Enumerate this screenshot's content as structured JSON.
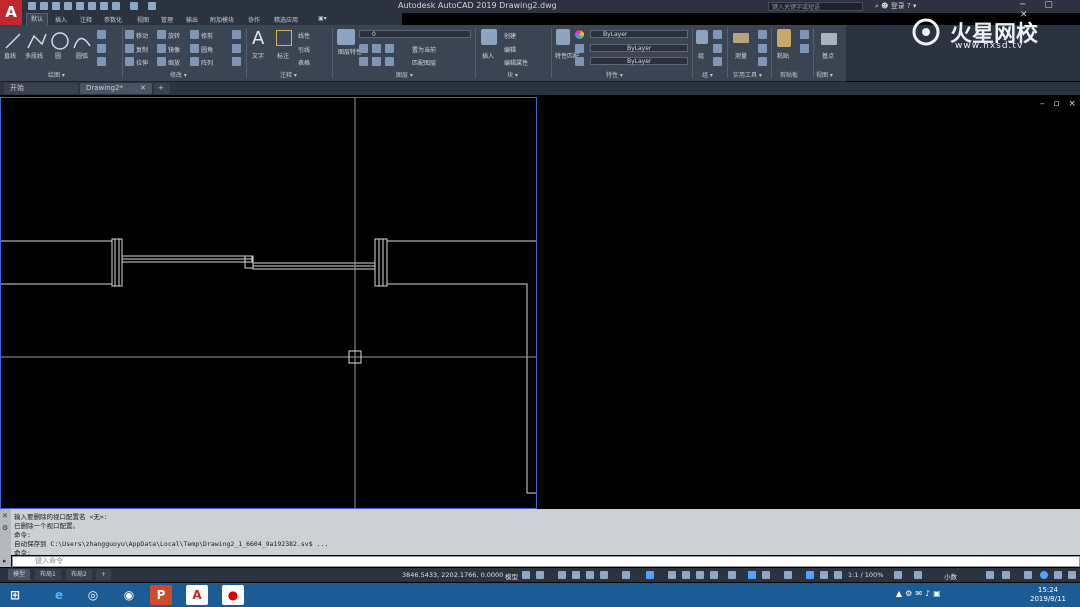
{
  "app": {
    "logo": "A",
    "title": "Autodesk AutoCAD 2019    Drawing2.dwg"
  },
  "titlebar": {
    "search_placeholder": "键入关键字或短语",
    "user": "登录",
    "controls": "─ ▢ ✕"
  },
  "ribbon_tabs": [
    "默认",
    "插入",
    "注释",
    "参数化",
    "视图",
    "管理",
    "输出",
    "附加模块",
    "协作",
    "精选应用"
  ],
  "panels": {
    "draw": {
      "label": "绘图 ▾",
      "tools": [
        "直线",
        "多段线",
        "圆",
        "圆弧"
      ]
    },
    "modify": {
      "label": "修改 ▾",
      "tools": [
        "移动",
        "旋转",
        "修剪",
        "复制",
        "镜像",
        "圆角",
        "拉伸",
        "缩放",
        "阵列"
      ]
    },
    "annotation": {
      "label": "注释 ▾",
      "tools": [
        "文字",
        "标注",
        "线性",
        "引线",
        "表格"
      ]
    },
    "layers": {
      "label": "图层 ▾",
      "tools": [
        "图层特性",
        "置为当前",
        "匹配图层"
      ],
      "current": "0"
    },
    "block": {
      "label": "块 ▾",
      "tools": [
        "插入",
        "创建",
        "编辑",
        "编辑属性"
      ]
    },
    "properties": {
      "label": "特性 ▾",
      "tools": [
        "特性匹配"
      ],
      "color": "ByLayer",
      "linetype": "ByLayer",
      "lineweight": "ByLayer"
    },
    "groups": {
      "label": "组 ▾",
      "tools": [
        "组"
      ]
    },
    "utilities": {
      "label": "实用工具 ▾",
      "tools": [
        "测量"
      ]
    },
    "clipboard": {
      "label": "剪贴板",
      "tools": [
        "粘贴"
      ]
    },
    "view": {
      "label": "视图 ▾",
      "tools": [
        "基点"
      ]
    }
  },
  "doc_tabs": [
    "开始",
    "Drawing2*",
    "+"
  ],
  "viewport_controls": "– ▫ ×",
  "command_history": [
    "输入要删除的视口配置名 <无>:",
    "已删除一个视口配置。",
    "命令:",
    "自动保存到 C:\\Users\\zhangguoyu\\AppData\\Local\\Temp\\Drawing2_1_6604_9a192382.sv$ ...",
    "命令:"
  ],
  "command_input": {
    "placeholder": "键入命令"
  },
  "layout_tabs": [
    "模型",
    "布局1",
    "布局2",
    "+"
  ],
  "status": {
    "coordinates": "3846.5433, 2202.1766, 0.0000",
    "mode": "模型",
    "scale": "1:1 / 100%",
    "units": "小数"
  },
  "taskbar": {
    "time": "15:24",
    "date": "2019/8/11"
  },
  "watermark": {
    "brand": "火星网校",
    "url": "www.hxsd.tv"
  },
  "colors": {
    "accent": "#3a6bd4",
    "app_red": "#c0282d",
    "ribbon_bg": "#3b4453",
    "taskbar": "#1b5c95"
  }
}
